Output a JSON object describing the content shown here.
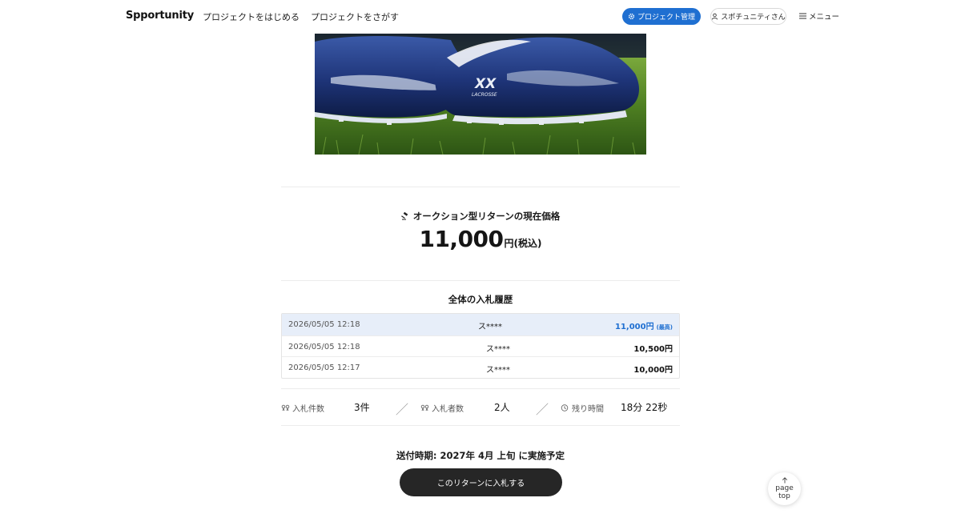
{
  "header": {
    "logo": "Spportunity",
    "nav": {
      "start": "プロジェクトをはじめる",
      "search": "プロジェクトをさがす"
    },
    "manage_label": "プロジェクト管理",
    "user_label": "スポチュニティさん",
    "menu_label": "メニュー"
  },
  "product": {
    "shoe_brand_text": "XX",
    "shoe_model_text": "LACROSSE"
  },
  "price": {
    "heading": "オークション型リターンの現在価格",
    "amount": "11,000",
    "suffix": "円(税込)"
  },
  "history": {
    "title": "全体の入札履歴",
    "rows": [
      {
        "date": "2026/05/05 12:18",
        "user": "ス****",
        "amount": "11,000円",
        "badge": "(最高)"
      },
      {
        "date": "2026/05/05 12:18",
        "user": "ス****",
        "amount": "10,500円",
        "badge": ""
      },
      {
        "date": "2026/05/05 12:17",
        "user": "ス****",
        "amount": "10,000円",
        "badge": ""
      }
    ]
  },
  "stats": {
    "bid_count_label": "入札件数",
    "bid_count_value": "3件",
    "bidders_label": "入札者数",
    "bidders_value": "2人",
    "remaining_label": "残り時間",
    "remaining_value": "18分 22秒",
    "separator": "／"
  },
  "shipping": "送付時期: 2027年 4月 上旬 に実施予定",
  "cta_label": "このリターンに入札する",
  "pagetop": {
    "line1": "page",
    "line2": "top"
  },
  "colors": {
    "accent": "#1f6fd1",
    "cta_bg": "#262626",
    "top_row_bg": "#e7eef9"
  }
}
